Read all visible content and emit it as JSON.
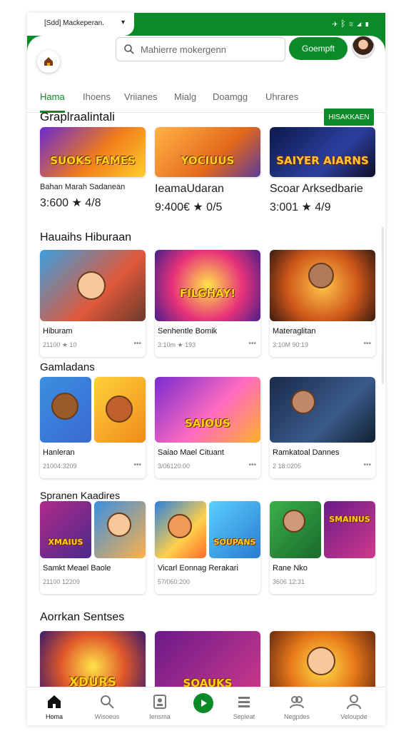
{
  "status": {
    "app_label": "[Sdd] Mackeperan.",
    "caret": "▾",
    "icons": [
      "airplane-icon",
      "bluetooth-icon",
      "wifi-icon",
      "signal-icon",
      "battery-icon"
    ]
  },
  "header": {
    "search_placeholder": "Mahierre mokergenn",
    "signin_label": "Goempft"
  },
  "tabs": [
    {
      "label": "Hama",
      "active": true
    },
    {
      "label": "Ihoens",
      "active": false
    },
    {
      "label": "Vriianes",
      "active": false
    },
    {
      "label": "Mialg",
      "active": false
    },
    {
      "label": "Doamgg",
      "active": false
    },
    {
      "label": "Uhrares",
      "active": false
    }
  ],
  "sections": [
    {
      "title": "Graplraalintali",
      "see_all": "HISAKKAEN",
      "items": [
        {
          "name": "Bahan Marah Sadanean",
          "meta": "3:600 ★ 4/8",
          "art": "SUOKS FAMES"
        },
        {
          "name": "IeamaUdaran",
          "meta": "9:400€ ★ 0/5",
          "art": "YOCIUUS"
        },
        {
          "name": "Scoar Arksedbarie",
          "meta": "3:001 ★ 4/9",
          "art": "SAIYER AIARNS"
        }
      ]
    },
    {
      "title": "Hauaihs Hiburaan",
      "items": [
        {
          "name": "Hiburam",
          "meta": "21100 ★ 10",
          "art": ""
        },
        {
          "name": "Senhentle Bomik",
          "meta": "3:10m ★ 193",
          "art": "FILGHAY!"
        },
        {
          "name": "Materaglitan",
          "meta": "3:10M 90:19",
          "art": ""
        }
      ]
    },
    {
      "title": "Gamladans",
      "items": [
        {
          "name": "Hanleran",
          "meta": "21004:3209",
          "art": ""
        },
        {
          "name": "Saiao Mael Cituant",
          "meta": "3/06120:00",
          "art": "SAIOUS"
        },
        {
          "name": "Ramkatoal Dannes",
          "meta": "2 18:0205",
          "art": ""
        }
      ]
    },
    {
      "title": "Spranen Kaadires",
      "items": [
        {
          "name": "Samkt Meael Baole",
          "meta": "21100 12209",
          "art": "XMAIUS"
        },
        {
          "name": "Vicarl Eonnag Rerakari",
          "meta": "57/060:200",
          "art": "SOUPANS"
        },
        {
          "name": "Rane Nko",
          "meta": "3606 12:31",
          "art": "SMAINUS"
        }
      ]
    },
    {
      "title": "Aorrkan Sentses",
      "items": [
        {
          "name": "",
          "meta": "",
          "art": "XDURS"
        },
        {
          "name": "",
          "meta": "",
          "art": "SOAUKS"
        },
        {
          "name": "",
          "meta": "",
          "art": ""
        }
      ]
    }
  ],
  "bottom_nav": [
    {
      "label": "Homa",
      "icon": "home-icon",
      "active": true
    },
    {
      "label": "Wisoeus",
      "icon": "search-icon",
      "active": false
    },
    {
      "label": "Iensma",
      "icon": "library-icon",
      "active": false
    },
    {
      "label": "",
      "icon": "play-icon",
      "active": false
    },
    {
      "label": "Sepleat",
      "icon": "list-icon",
      "active": false
    },
    {
      "label": "Negpdes",
      "icon": "people-icon",
      "active": false
    },
    {
      "label": "Veloupde",
      "icon": "profile-icon",
      "active": false
    }
  ],
  "colors": {
    "brand": "#0b8a28",
    "text": "#202124",
    "muted": "#888888"
  }
}
